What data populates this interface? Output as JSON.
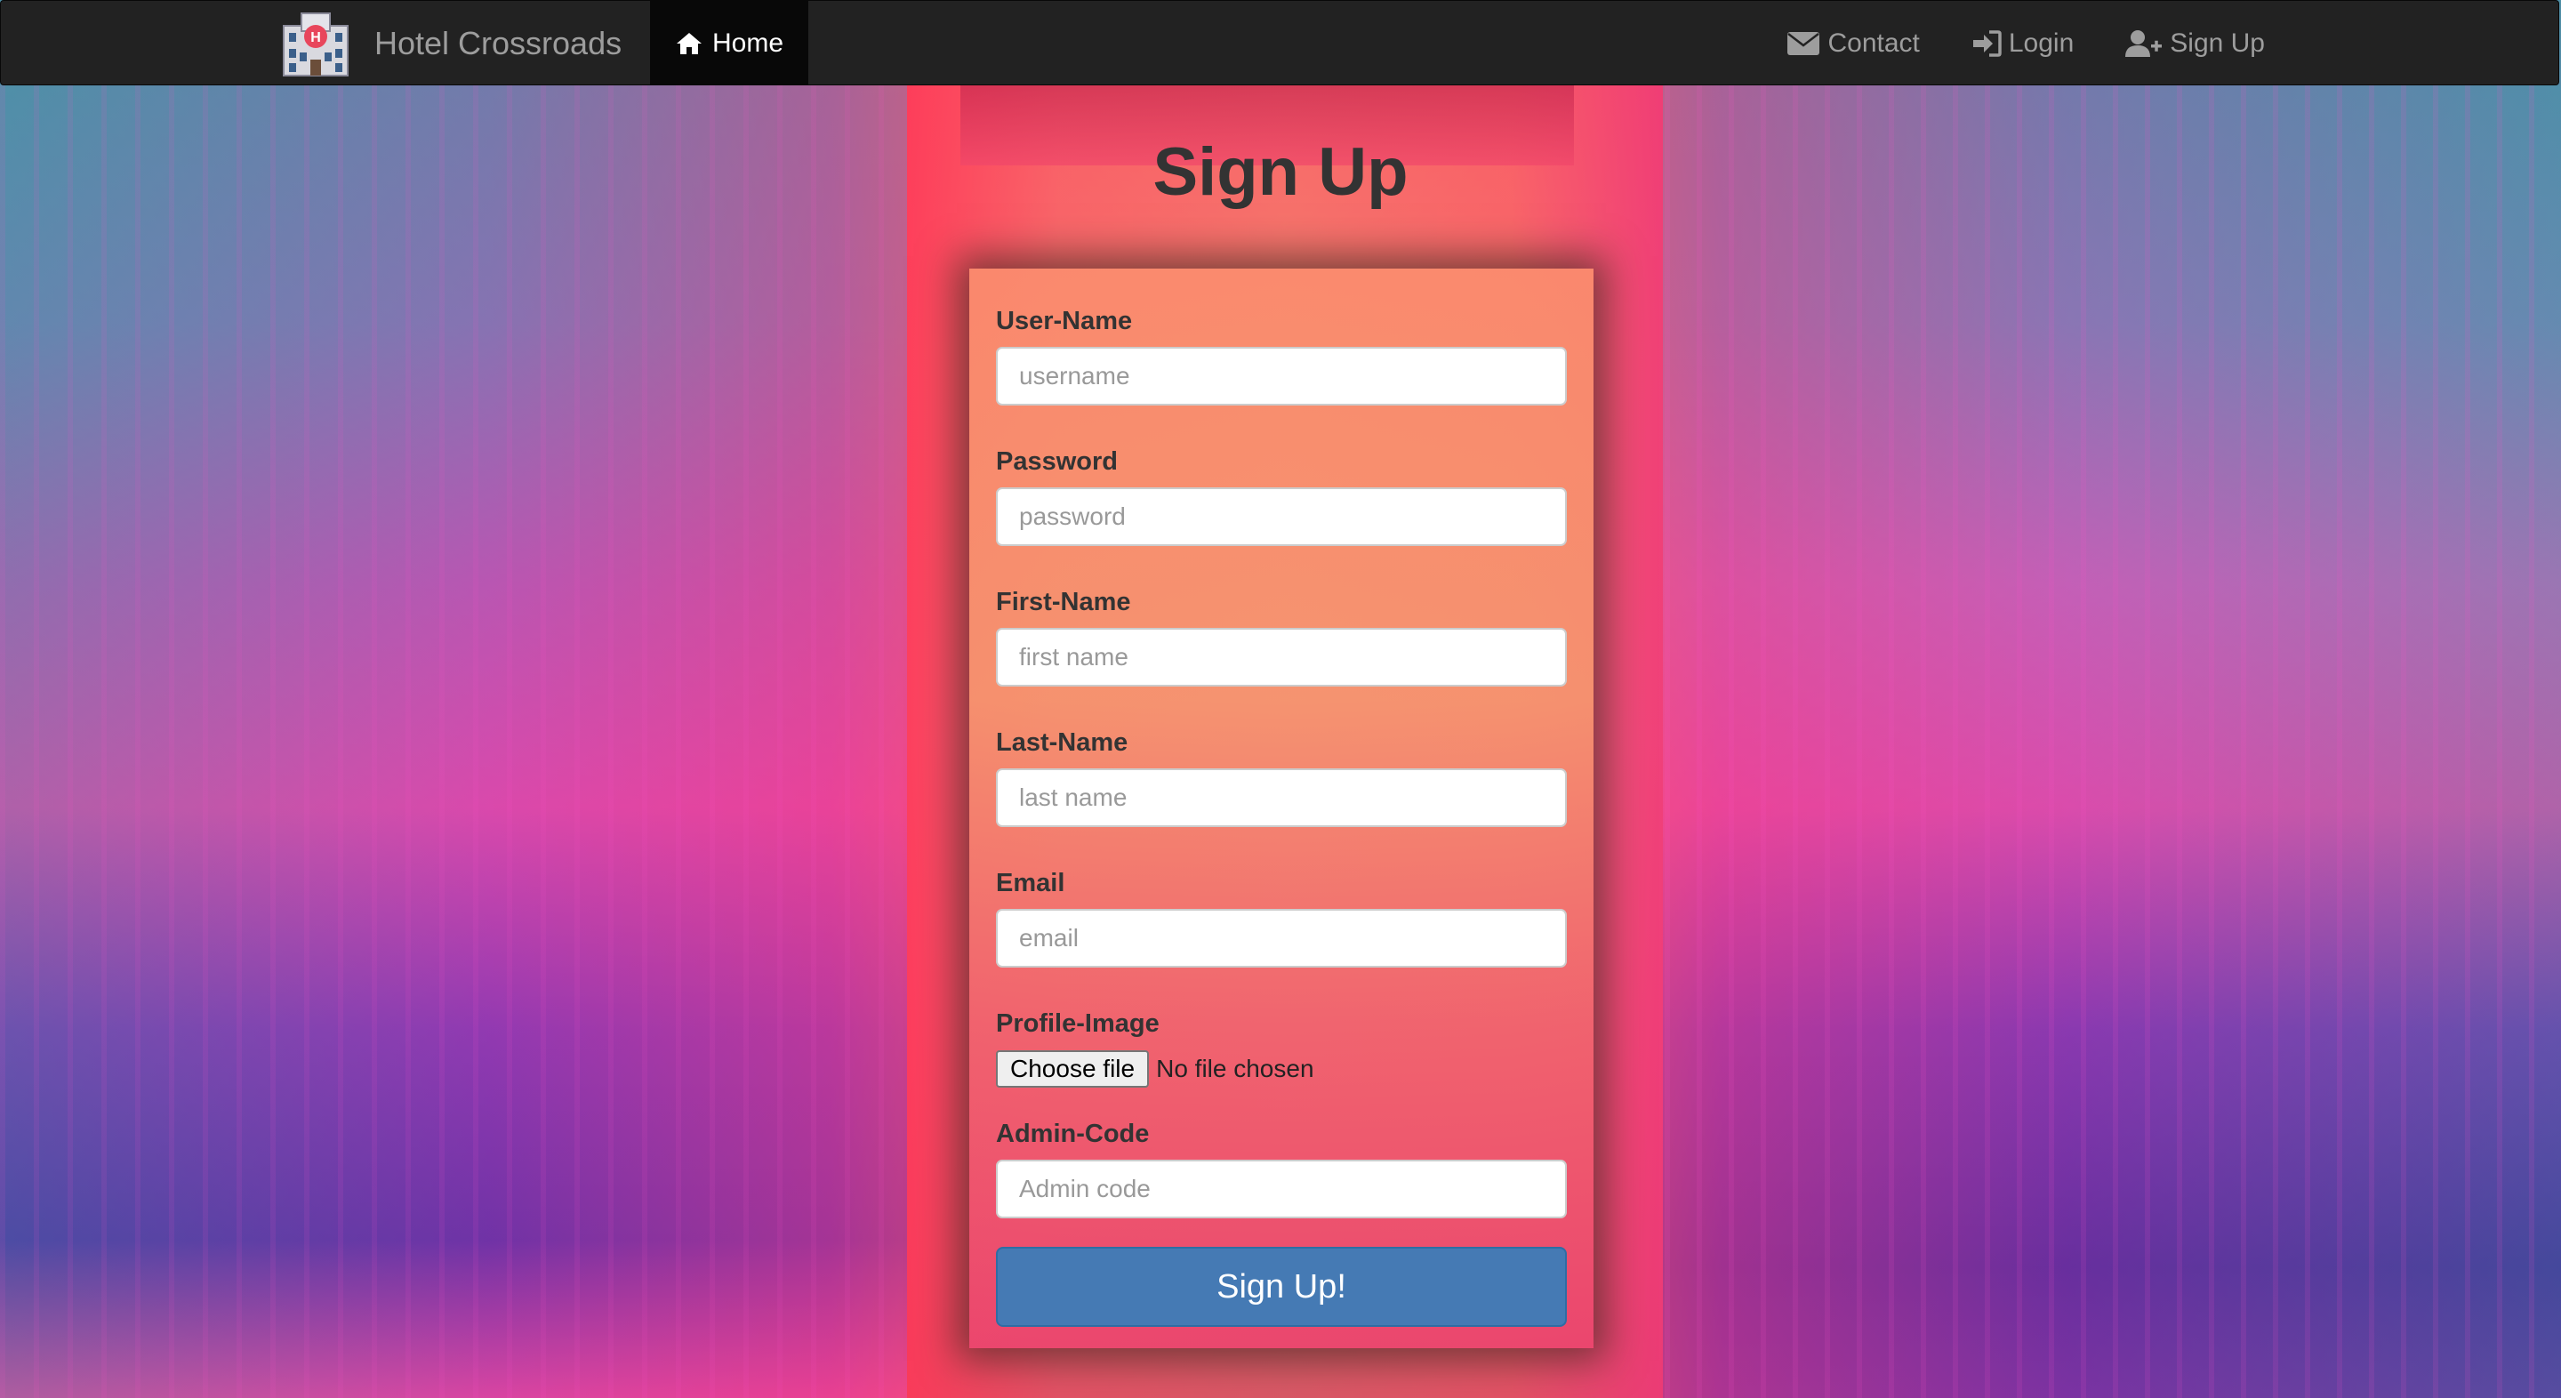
{
  "navbar": {
    "brand": "Hotel Crossroads",
    "home_label": "Home",
    "links": {
      "contact": "Contact",
      "login": "Login",
      "signup": "Sign Up"
    }
  },
  "page": {
    "title": "Sign Up"
  },
  "form": {
    "fields": {
      "username": {
        "label": "User-Name",
        "placeholder": "username",
        "value": ""
      },
      "password": {
        "label": "Password",
        "placeholder": "password",
        "value": ""
      },
      "first_name": {
        "label": "First-Name",
        "placeholder": "first name",
        "value": ""
      },
      "last_name": {
        "label": "Last-Name",
        "placeholder": "last name",
        "value": ""
      },
      "email": {
        "label": "Email",
        "placeholder": "email",
        "value": ""
      },
      "profile_image": {
        "label": "Profile-Image",
        "button": "Choose file",
        "status": "No file chosen"
      },
      "admin_code": {
        "label": "Admin-Code",
        "placeholder": "Admin code",
        "value": ""
      }
    },
    "submit_label": "Sign Up!"
  },
  "colors": {
    "navbar_bg": "#222222",
    "nav_active_bg": "#080808",
    "nav_text": "#9d9d9d",
    "button_primary": "#457ab4"
  },
  "icons": {
    "brand": "hotel-icon",
    "home": "home-icon",
    "contact": "envelope-icon",
    "login": "sign-in-icon",
    "signup": "user-plus-icon"
  }
}
